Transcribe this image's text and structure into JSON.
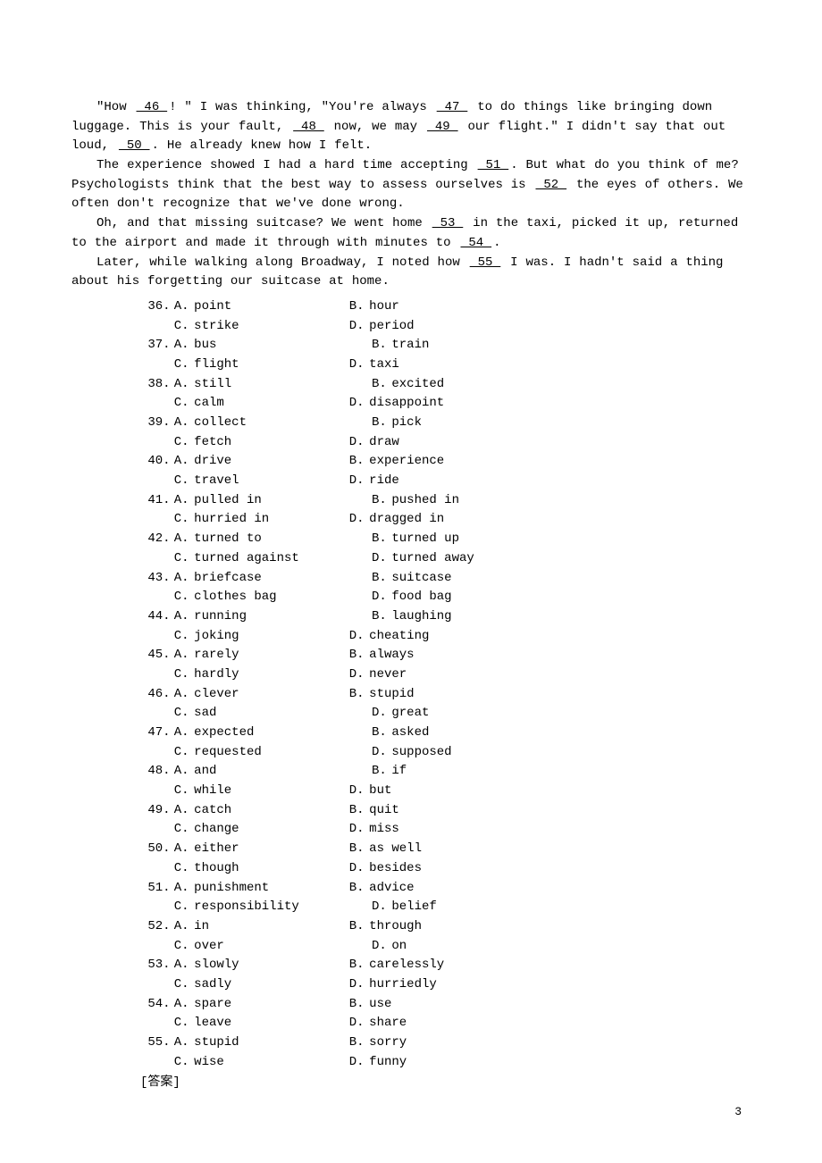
{
  "paragraphs": [
    "“How 　 46 　! ” I was thinking, “You're always 　 47 　 to do things like bringing down luggage. This is your fault, 　 48 　 now, we may 　 49 　 our flight.” I didn't say that out loud, 　 50 　. He already knew how I felt.",
    "The experience showed I had a hard time accepting 　 51 　. But what do you think of me? Psychologists think that the best way to assess ourselves is 　 52 　 the eyes of others. We often don't recognize that we've done wrong.",
    "Oh, and that missing suitcase? We went home 　 53 　 in the taxi, picked it up, returned to the airport and made it through with minutes to 　 54 　.",
    "Later, while walking along Broadway, I noted how 　 55 　 I was. I hadn't said a thing about his forgetting our suitcase at home."
  ],
  "questions": [
    {
      "num": "36.",
      "a": "point",
      "b": "hour",
      "c": "strike",
      "d": "period",
      "b_indent": 0,
      "d_indent": 0
    },
    {
      "num": "37.",
      "a": "bus",
      "b": "train",
      "c": "flight",
      "d": "taxi",
      "b_indent": 2,
      "d_indent": 0
    },
    {
      "num": "38.",
      "a": "still",
      "b": "excited",
      "c": "calm",
      "d": "disappoint",
      "b_indent": 2,
      "d_indent": 0
    },
    {
      "num": "39.",
      "a": "collect",
      "b": "pick",
      "c": "fetch",
      "d": "draw",
      "b_indent": 2,
      "d_indent": 0
    },
    {
      "num": "40.",
      "a": "drive",
      "b": "experience",
      "c": "travel",
      "d": "ride",
      "b_indent": 0,
      "d_indent": 0
    },
    {
      "num": "41.",
      "a": "pulled in",
      "b": "pushed in",
      "c": "hurried in",
      "d": "dragged in",
      "b_indent": 2,
      "d_indent": 0
    },
    {
      "num": "42.",
      "a": "turned to",
      "b": "turned up",
      "c": "turned against",
      "d": "turned away",
      "b_indent": 2,
      "d_indent": 2
    },
    {
      "num": "43.",
      "a": "briefcase",
      "b": "suitcase",
      "c": "clothes bag",
      "d": "food bag",
      "b_indent": 2,
      "d_indent": 2
    },
    {
      "num": "44.",
      "a": "running",
      "b": "laughing",
      "c": "joking",
      "d": "cheating",
      "b_indent": 2,
      "d_indent": 0
    },
    {
      "num": "45.",
      "a": "rarely",
      "b": "always",
      "c": "hardly",
      "d": "never",
      "b_indent": 0,
      "d_indent": 0
    },
    {
      "num": "46.",
      "a": "clever",
      "b": "stupid",
      "c": "sad",
      "d": "great",
      "b_indent": 0,
      "d_indent": 2
    },
    {
      "num": "47.",
      "a": "expected",
      "b": "asked",
      "c": "requested",
      "d": "supposed",
      "b_indent": 2,
      "d_indent": 2
    },
    {
      "num": "48.",
      "a": "and",
      "b": "if",
      "c": "while",
      "d": "but",
      "b_indent": 2,
      "d_indent": 0
    },
    {
      "num": "49.",
      "a": "catch",
      "b": "quit",
      "c": "change",
      "d": "miss",
      "b_indent": 0,
      "d_indent": 0
    },
    {
      "num": "50.",
      "a": "either",
      "b": "as well",
      "c": "though",
      "d": "besides",
      "b_indent": 0,
      "d_indent": 0
    },
    {
      "num": "51.",
      "a": "punishment",
      "b": "advice",
      "c": "responsibility",
      "d": "belief",
      "b_indent": 0,
      "d_indent": 2
    },
    {
      "num": "52.",
      "a": "in",
      "b": "through",
      "c": "over",
      "d": "on",
      "b_indent": 0,
      "d_indent": 2
    },
    {
      "num": "53.",
      "a": "slowly",
      "b": "carelessly",
      "c": "sadly",
      "d": "hurriedly",
      "b_indent": 0,
      "d_indent": 0
    },
    {
      "num": "54.",
      "a": "spare",
      "b": "use",
      "c": "leave",
      "d": "share",
      "b_indent": 0,
      "d_indent": 0
    },
    {
      "num": "55.",
      "a": "stupid",
      "b": "sorry",
      "c": "wise",
      "d": "funny",
      "b_indent": 0,
      "d_indent": 0
    }
  ],
  "answer_label": "[答案]",
  "page_number": "3"
}
